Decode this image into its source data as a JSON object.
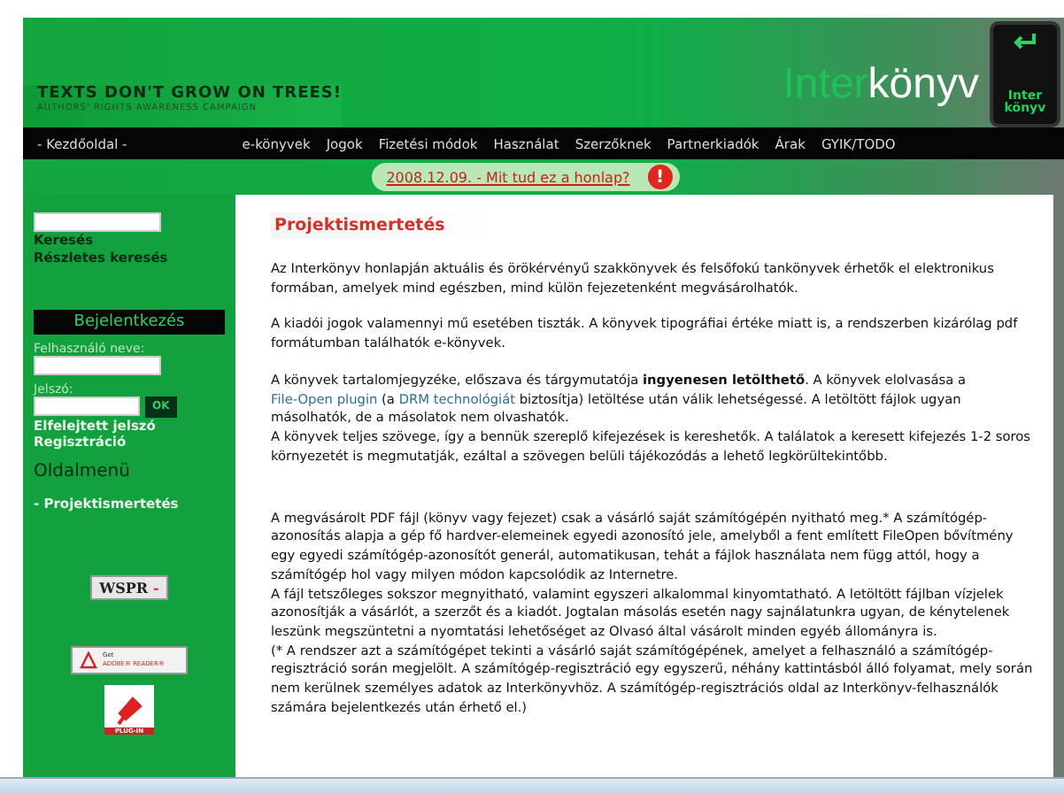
{
  "header": {
    "slogan": "TEXTS DON'T GROW ON TREES!",
    "subslogan": "AUTHORS' RIGHTS AWARENESS CAMPAIGN",
    "logo_prefix": "Inter",
    "logo_suffix": "könyv",
    "key_label": "Inter könyv"
  },
  "nav": {
    "home": "- Kezdőoldal -",
    "items": [
      "e-könyvek",
      "Jogok",
      "Fizetési módok",
      "Használat",
      "Szerzőknek",
      "Partnerkiadók",
      "Árak",
      "GYIK/TODO"
    ]
  },
  "notice": {
    "link": "2008.12.09. - Mit tud ez a honlap?",
    "icon": "!"
  },
  "sidebar": {
    "search_links": [
      "Keresés",
      "Részletes keresés"
    ],
    "login": {
      "title": "Bejelentkezés",
      "username_label": "Felhasználó neve:",
      "password_label": "Jelszó:",
      "ok": "OK",
      "links": [
        "Elfelejtett jelszó",
        "Regisztráció"
      ]
    },
    "menu_title": "Oldalmenü",
    "menu_items": [
      "- Projektismertetés"
    ],
    "badges": {
      "wspr": "WSPR",
      "wspr_mark": "-",
      "adobe_get": "Get",
      "adobe_name": "ADOBE® READER®",
      "plugin": "PLUG-IN"
    }
  },
  "content": {
    "title": "Projektismertetés",
    "sections": [
      [
        [
          {
            "kind": "text",
            "text": "Az Interkönyv honlapján aktuális és örökérvényű szakkönyvek és felsőfokú tankönyvek érhetők el elektronikus formában, amelyek mind egészben, mind külön fejezetenként megvásárolhatók."
          }
        ]
      ],
      [
        [
          {
            "kind": "text",
            "text": "A kiadói jogok valamennyi mű esetében tiszták. A könyvek tipográfiai értéke miatt is, a rendszerben kizárólag pdf formátumban találhatók e-könyvek."
          }
        ]
      ],
      [
        [
          {
            "kind": "text",
            "text": "A könyvek tartalomjegyzéke, előszava és tárgymutatója "
          },
          {
            "kind": "bold",
            "text": "ingyenesen letölthető"
          },
          {
            "kind": "text",
            "text": ". A könyvek elolvasása a "
          },
          {
            "kind": "link",
            "text": "File-Open plugin"
          },
          {
            "kind": "text",
            "text": " (a "
          },
          {
            "kind": "link",
            "text": "DRM technológiát"
          },
          {
            "kind": "text",
            "text": " biztosítja) letöltése után válik lehetségessé. A letöltött fájlok ugyan másolhatók, de a másolatok nem olvashatók."
          }
        ],
        [
          {
            "kind": "text",
            "text": "A könyvek teljes szövege, így a bennük szereplő kifejezések is kereshetők. A találatok a keresett kifejezés 1-2 soros környezetét is megmutatják, ezáltal a szövegen belüli tájékozódás a lehető legkörültekintőbb."
          }
        ]
      ],
      [
        [
          {
            "kind": "text",
            "text": "A megvásárolt PDF fájl (könyv vagy fejezet) csak a vásárló saját számítógépén nyitható meg.* A számítógép-azonosítás alapja a gép fő hardver-elemeinek egyedi azonosító jele, amelyből a fent említett FileOpen bővítmény egy egyedi számítógép-azonosítót generál, automatikusan, tehát a fájlok használata nem függ attól, hogy a számítógép hol vagy milyen módon kapcsolódik az Internetre."
          }
        ],
        [
          {
            "kind": "text",
            "text": "A fájl tetszőleges sokszor megnyitható, valamint egyszeri alkalommal kinyomtatható. A letöltött fájlban vízjelek azonosítják a vásárlót, a szerzőt és a kiadót. Jogtalan másolás esetén nagy sajnálatunkra ugyan, de kénytelenek leszünk megszüntetni a nyomtatási lehetőséget az Olvasó által vásárolt minden egyéb állományra is."
          }
        ],
        [
          {
            "kind": "text",
            "text": "(* A rendszer azt a számítógépet tekinti a vásárló saját számítógépének, amelyet a felhasználó a számítógép-regisztráció során megjelölt. A számítógép-regisztráció egy egyszerű, néhány kattintásból álló folyamat, mely során nem kerülnek személyes adatok az Interkönyvhöz. A számítógép-regisztrációs oldal az Interkönyv-felhasználók számára bejelentkezés után érhető el.)"
          }
        ]
      ]
    ]
  }
}
